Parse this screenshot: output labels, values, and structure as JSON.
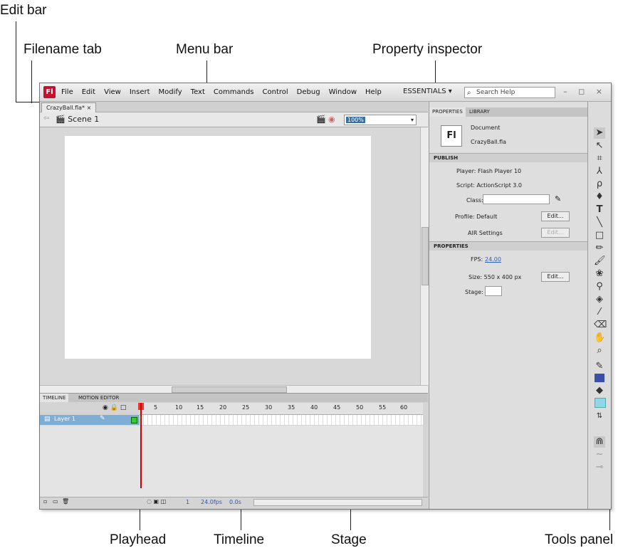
{
  "callouts": {
    "edit_bar": "Edit bar",
    "filename_tab": "Filename tab",
    "menu_bar": "Menu bar",
    "property_inspector": "Property inspector",
    "playhead": "Playhead",
    "timeline": "Timeline",
    "stage": "Stage",
    "tools_panel": "Tools panel"
  },
  "app": {
    "logo": "Fl",
    "menus": [
      "File",
      "Edit",
      "View",
      "Insert",
      "Modify",
      "Text",
      "Commands",
      "Control",
      "Debug",
      "Window",
      "Help"
    ],
    "workspace": "ESSENTIALS ▾",
    "search_placeholder": "Search Help",
    "window_controls": "– ◻ ×"
  },
  "document": {
    "tab_label": "CrazyBall.fla* ×",
    "scene": "Scene 1",
    "zoom": "100%"
  },
  "timeline": {
    "tabs": [
      "TIMELINE",
      "MOTION EDITOR"
    ],
    "layer_name": "Layer 1",
    "frame_numbers": [
      "5",
      "10",
      "15",
      "20",
      "25",
      "30",
      "35",
      "40",
      "45",
      "50",
      "55",
      "60"
    ],
    "status_frame": "1",
    "status_fps": "24.0fps",
    "status_time": "0.0s"
  },
  "properties": {
    "tabs": [
      "PROPERTIES",
      "LIBRARY"
    ],
    "doc_icon": "Fl",
    "doc_type": "Document",
    "doc_name": "CrazyBall.fla",
    "publish_header": "PUBLISH",
    "player": "Player: Flash Player 10",
    "script": "Script: ActionScript 3.0",
    "class_label": "Class:",
    "profile": "Profile: Default",
    "edit_label": "Edit...",
    "air_settings": "AIR Settings",
    "properties_header": "PROPERTIES",
    "fps_label": "FPS:",
    "fps_value": "24.00",
    "size": "Size: 550 x 400 px",
    "stage_label": "Stage:"
  },
  "tools": [
    "arrow",
    "subselect",
    "free-transform",
    "3d-rotation",
    "lasso",
    "pen",
    "text",
    "line",
    "rectangle",
    "pencil",
    "brush",
    "deco",
    "bone",
    "paint-bucket",
    "eyedropper",
    "eraser",
    "hand",
    "zoom",
    "stroke-color",
    "fill-color",
    "swap-colors",
    "snap"
  ],
  "colors": {
    "stroke_swatch": "#3b4ea8",
    "fill_swatch": "#8ed6e8",
    "layer_selected": "#7eaed6",
    "playhead": "#cc0000"
  }
}
